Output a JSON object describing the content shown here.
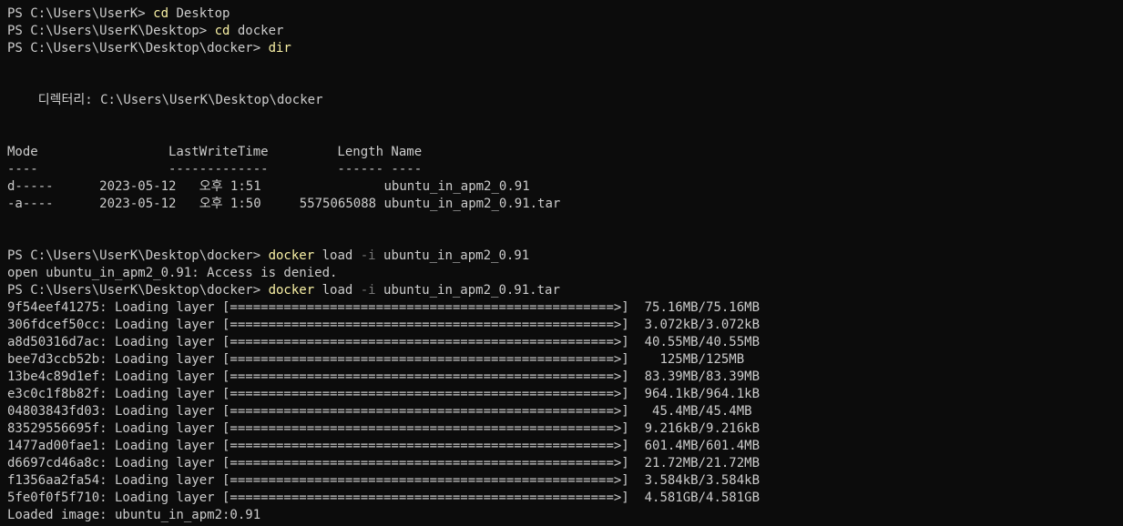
{
  "colors": {
    "background": "#0c0c0c",
    "text": "#cccccc",
    "command": "#f9f1a5",
    "parameter": "#767676"
  },
  "lines": [
    {
      "segments": [
        {
          "t": "PS C:\\Users\\UserK> ",
          "c": "txt"
        },
        {
          "t": "cd",
          "c": "cmd"
        },
        {
          "t": " Desktop",
          "c": "txt"
        }
      ]
    },
    {
      "segments": [
        {
          "t": "PS C:\\Users\\UserK\\Desktop> ",
          "c": "txt"
        },
        {
          "t": "cd",
          "c": "cmd"
        },
        {
          "t": " docker",
          "c": "txt"
        }
      ]
    },
    {
      "segments": [
        {
          "t": "PS C:\\Users\\UserK\\Desktop\\docker> ",
          "c": "txt"
        },
        {
          "t": "dir",
          "c": "cmd"
        }
      ]
    },
    {
      "segments": []
    },
    {
      "segments": []
    },
    {
      "segments": [
        {
          "t": "    디렉터리: C:\\Users\\UserK\\Desktop\\docker",
          "c": "txt"
        }
      ]
    },
    {
      "segments": []
    },
    {
      "segments": []
    },
    {
      "segments": [
        {
          "t": "Mode                 LastWriteTime         Length Name",
          "c": "txt"
        }
      ]
    },
    {
      "segments": [
        {
          "t": "----                 -------------         ------ ----",
          "c": "txt"
        }
      ]
    },
    {
      "segments": [
        {
          "t": "d-----      2023-05-12   오후 1:51                ubuntu_in_apm2_0.91",
          "c": "txt"
        }
      ]
    },
    {
      "segments": [
        {
          "t": "-a----      2023-05-12   오후 1:50     5575065088 ubuntu_in_apm2_0.91.tar",
          "c": "txt"
        }
      ]
    },
    {
      "segments": []
    },
    {
      "segments": []
    },
    {
      "segments": [
        {
          "t": "PS C:\\Users\\UserK\\Desktop\\docker> ",
          "c": "txt"
        },
        {
          "t": "docker",
          "c": "cmd"
        },
        {
          "t": " load ",
          "c": "txt"
        },
        {
          "t": "-i",
          "c": "param"
        },
        {
          "t": " ubuntu_in_apm2_0.91",
          "c": "txt"
        }
      ]
    },
    {
      "segments": [
        {
          "t": "open ubuntu_in_apm2_0.91: Access is denied.",
          "c": "txt"
        }
      ]
    },
    {
      "segments": [
        {
          "t": "PS C:\\Users\\UserK\\Desktop\\docker> ",
          "c": "txt"
        },
        {
          "t": "docker",
          "c": "cmd"
        },
        {
          "t": " load ",
          "c": "txt"
        },
        {
          "t": "-i",
          "c": "param"
        },
        {
          "t": " ubuntu_in_apm2_0.91.tar",
          "c": "txt"
        }
      ]
    },
    {
      "segments": [
        {
          "t": "9f54eef41275: Loading layer [==================================================>]  75.16MB/75.16MB",
          "c": "txt"
        }
      ]
    },
    {
      "segments": [
        {
          "t": "306fdcef50cc: Loading layer [==================================================>]  3.072kB/3.072kB",
          "c": "txt"
        }
      ]
    },
    {
      "segments": [
        {
          "t": "a8d50316d7ac: Loading layer [==================================================>]  40.55MB/40.55MB",
          "c": "txt"
        }
      ]
    },
    {
      "segments": [
        {
          "t": "bee7d3ccb52b: Loading layer [==================================================>]    125MB/125MB",
          "c": "txt"
        }
      ]
    },
    {
      "segments": [
        {
          "t": "13be4c89d1ef: Loading layer [==================================================>]  83.39MB/83.39MB",
          "c": "txt"
        }
      ]
    },
    {
      "segments": [
        {
          "t": "e3c0c1f8b82f: Loading layer [==================================================>]  964.1kB/964.1kB",
          "c": "txt"
        }
      ]
    },
    {
      "segments": [
        {
          "t": "04803843fd03: Loading layer [==================================================>]   45.4MB/45.4MB",
          "c": "txt"
        }
      ]
    },
    {
      "segments": [
        {
          "t": "83529556695f: Loading layer [==================================================>]  9.216kB/9.216kB",
          "c": "txt"
        }
      ]
    },
    {
      "segments": [
        {
          "t": "1477ad00fae1: Loading layer [==================================================>]  601.4MB/601.4MB",
          "c": "txt"
        }
      ]
    },
    {
      "segments": [
        {
          "t": "d6697cd46a8c: Loading layer [==================================================>]  21.72MB/21.72MB",
          "c": "txt"
        }
      ]
    },
    {
      "segments": [
        {
          "t": "f1356aa2fa54: Loading layer [==================================================>]  3.584kB/3.584kB",
          "c": "txt"
        }
      ]
    },
    {
      "segments": [
        {
          "t": "5fe0f0f5f710: Loading layer [==================================================>]  4.581GB/4.581GB",
          "c": "txt"
        }
      ]
    },
    {
      "segments": [
        {
          "t": "Loaded image: ubuntu_in_apm2:0.91",
          "c": "txt"
        }
      ]
    }
  ]
}
